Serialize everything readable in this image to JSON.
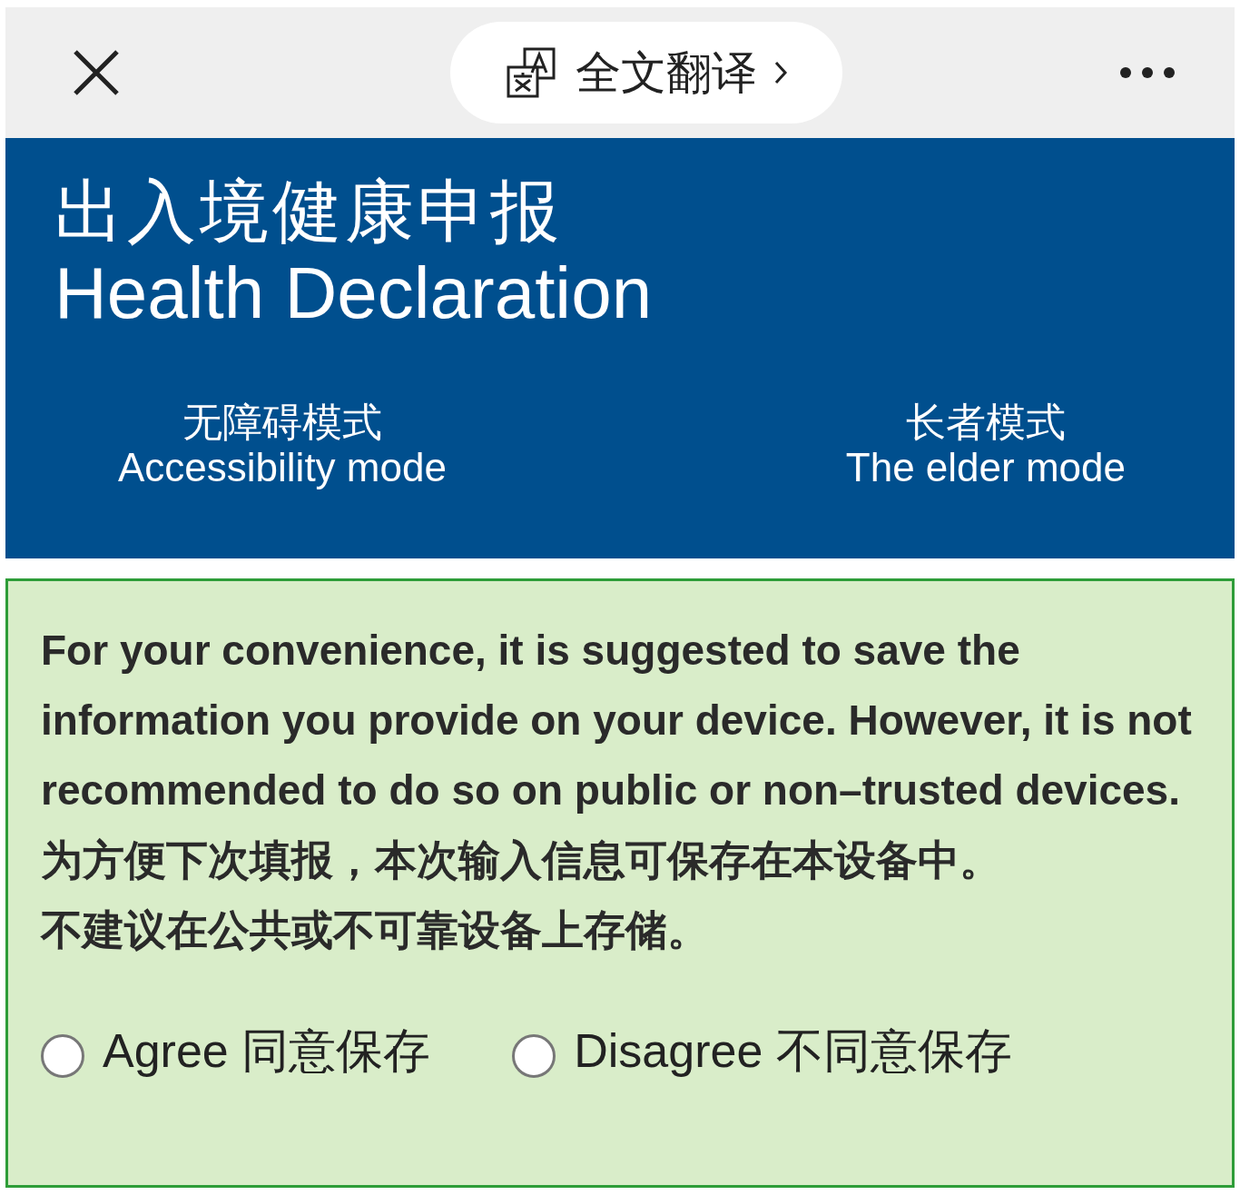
{
  "top_bar": {
    "translate_button": {
      "label": "全文翻译"
    }
  },
  "header": {
    "title_zh": "出入境健康申报",
    "title_en": "Health Declaration",
    "modes": [
      {
        "zh": "无障碍模式",
        "en": "Accessibility mode"
      },
      {
        "zh": "长者模式",
        "en": "The elder mode"
      }
    ]
  },
  "notice": {
    "paragraphs": [
      "For your convenience, it is suggested to save the information you provide on your device. However, it is not recommended to do so on public or non–trusted devices.",
      "为方便下次填报，本次输入信息可保存在本设备中。",
      "不建议在公共或不可靠设备上存储。"
    ],
    "options": [
      {
        "label": "Agree 同意保存",
        "selected": false
      },
      {
        "label": "Disagree 不同意保存",
        "selected": false
      }
    ]
  }
}
